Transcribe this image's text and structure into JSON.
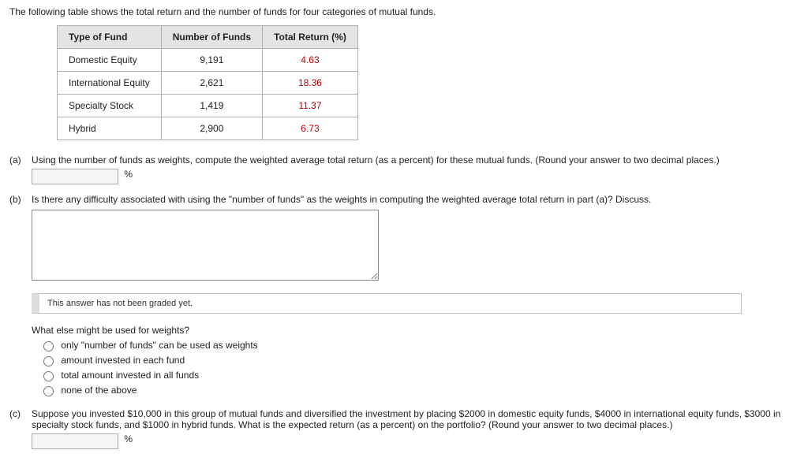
{
  "intro": "The following table shows the total return and the number of funds for four categories of mutual funds.",
  "table": {
    "headers": [
      "Type of Fund",
      "Number of Funds",
      "Total Return (%)"
    ],
    "rows": [
      {
        "type": "Domestic Equity",
        "num": "9,191",
        "ret": "4.63"
      },
      {
        "type": "International Equity",
        "num": "2,621",
        "ret": "18.36"
      },
      {
        "type": "Specialty Stock",
        "num": "1,419",
        "ret": "11.37"
      },
      {
        "type": "Hybrid",
        "num": "2,900",
        "ret": "6.73"
      }
    ]
  },
  "chart_data": {
    "type": "table",
    "title": "Total return and number of funds for four categories of mutual funds",
    "columns": [
      "Type of Fund",
      "Number of Funds",
      "Total Return (%)"
    ],
    "rows": [
      [
        "Domestic Equity",
        9191,
        4.63
      ],
      [
        "International Equity",
        2621,
        18.36
      ],
      [
        "Specialty Stock",
        1419,
        11.37
      ],
      [
        "Hybrid",
        2900,
        6.73
      ]
    ]
  },
  "part_a": {
    "label": "(a)",
    "text": "Using the number of funds as weights, compute the weighted average total return (as a percent) for these mutual funds. (Round your answer to two decimal places.)",
    "unit": "%"
  },
  "part_b": {
    "label": "(b)",
    "text": "Is there any difficulty associated with using the \"number of funds\" as the weights in computing the weighted average total return in part (a)? Discuss.",
    "grade_status": "This answer has not been graded yet.",
    "subq": "What else might be used for weights?",
    "options": [
      "only \"number of funds\" can be used as weights",
      "amount invested in each fund",
      "total amount invested in all funds",
      "none of the above"
    ]
  },
  "part_c": {
    "label": "(c)",
    "text": "Suppose you invested $10,000 in this group of mutual funds and diversified the investment by placing $2000 in domestic equity funds, $4000 in international equity funds, $3000 in specialty stock funds, and $1000 in hybrid funds. What is the expected return (as a percent) on the portfolio? (Round your answer to two decimal places.)",
    "unit": "%"
  }
}
